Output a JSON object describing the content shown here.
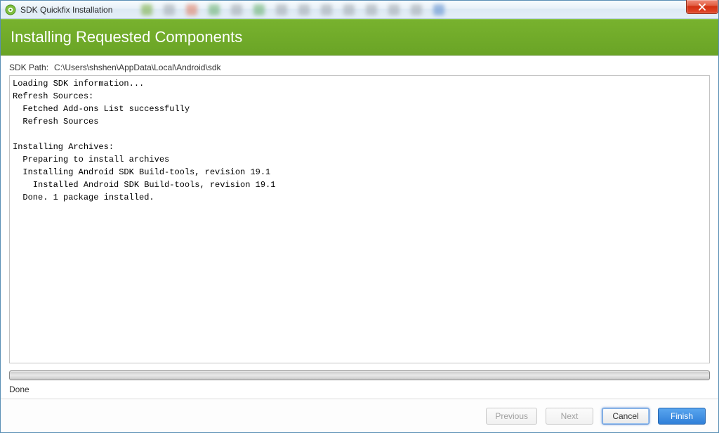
{
  "window": {
    "title": "SDK Quickfix Installation"
  },
  "header": {
    "title": "Installing Requested Components"
  },
  "sdk_path": {
    "label": "SDK Path:",
    "value": "C:\\Users\\shshen\\AppData\\Local\\Android\\sdk"
  },
  "log": {
    "lines": [
      "Loading SDK information...",
      "Refresh Sources:",
      "  Fetched Add-ons List successfully",
      "  Refresh Sources",
      "",
      "Installing Archives:",
      "  Preparing to install archives",
      "  Installing Android SDK Build-tools, revision 19.1",
      "    Installed Android SDK Build-tools, revision 19.1",
      "  Done. 1 package installed."
    ]
  },
  "status": {
    "text": "Done"
  },
  "footer": {
    "previous": "Previous",
    "next": "Next",
    "cancel": "Cancel",
    "finish": "Finish"
  },
  "icons": {
    "app": "android-studio-icon",
    "close": "close-icon"
  },
  "colors": {
    "header_bg": "#6aa426",
    "primary_btn": "#2f7fd8"
  }
}
